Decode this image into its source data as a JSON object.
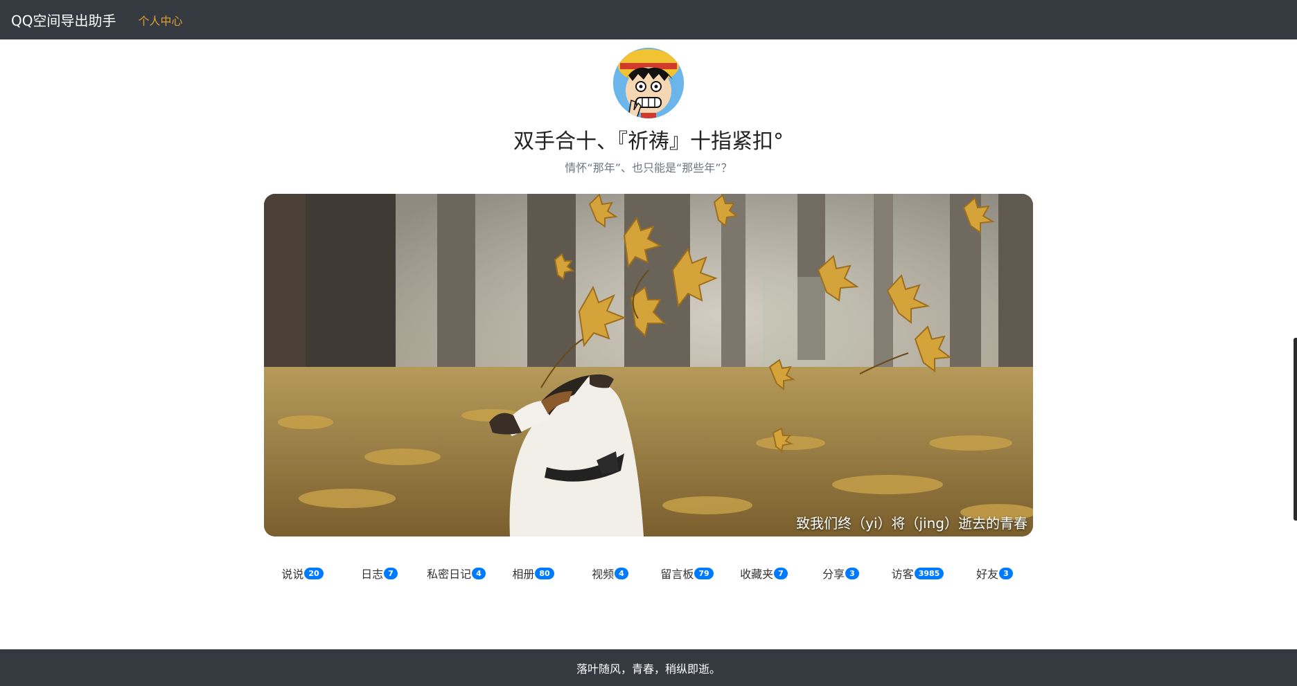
{
  "navbar": {
    "brand": "QQ空间导出助手",
    "link": "个人中心"
  },
  "profile": {
    "avatar_icon": "avatar-cartoon-straw-hat",
    "name": "双手合十、『祈祷』十指紧扣°",
    "signature": "情怀“那年”、也只能是“那些年”？"
  },
  "cover": {
    "caption": "致我们终（yi）将（jing）逝去的青春"
  },
  "menu": {
    "items": [
      {
        "label": "说说",
        "count": "20"
      },
      {
        "label": "日志",
        "count": "7"
      },
      {
        "label": "私密日记",
        "count": "4"
      },
      {
        "label": "相册",
        "count": "80"
      },
      {
        "label": "视频",
        "count": "4"
      },
      {
        "label": "留言板",
        "count": "79"
      },
      {
        "label": "收藏夹",
        "count": "7"
      },
      {
        "label": "分享",
        "count": "3"
      },
      {
        "label": "访客",
        "count": "3985"
      },
      {
        "label": "好友",
        "count": "3"
      }
    ]
  },
  "footer": {
    "text": "落叶随风，青春，稍纵即逝。"
  },
  "colors": {
    "navbar_bg": "#343a40",
    "link_color": "#e0a030",
    "badge_bg": "#007bff"
  }
}
